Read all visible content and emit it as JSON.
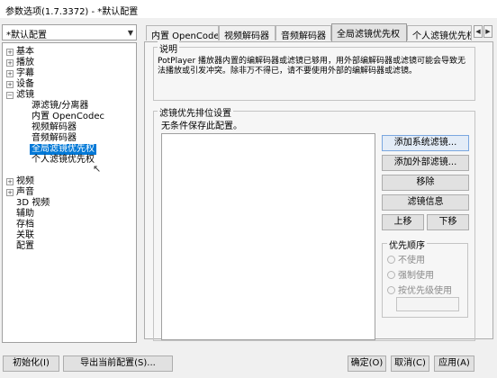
{
  "window": {
    "title": "参数选项(1.7.3372) - *默认配置"
  },
  "preset": {
    "value": "*默认配置"
  },
  "tabs": [
    {
      "label": "内置 OpenCodec"
    },
    {
      "label": "视频解码器"
    },
    {
      "label": "音频解码器"
    },
    {
      "label": "全局滤镜优先权"
    },
    {
      "label": "个人滤镜优先权"
    }
  ],
  "tree": {
    "items": [
      {
        "label": "基本",
        "exp": "+"
      },
      {
        "label": "播放",
        "exp": "+"
      },
      {
        "label": "字幕",
        "exp": "+"
      },
      {
        "label": "设备",
        "exp": "+"
      },
      {
        "label": "滤镜",
        "exp": "−"
      },
      {
        "label": "源滤镜/分离器"
      },
      {
        "label": "内置 OpenCodec"
      },
      {
        "label": "视频解码器"
      },
      {
        "label": "音频解码器"
      },
      {
        "label": "全局滤镜优先权"
      },
      {
        "label": "个人滤镜优先权"
      },
      {
        "label": "视频",
        "exp": "+"
      },
      {
        "label": "声音",
        "exp": "+"
      },
      {
        "label": "3D 视频"
      },
      {
        "label": "辅助"
      },
      {
        "label": "存档"
      },
      {
        "label": "关联"
      },
      {
        "label": "配置"
      }
    ]
  },
  "info": {
    "title": "说明",
    "text": "PotPlayer 播放器内置的编解码器或滤镜已够用，用外部编解码器或滤镜可能会导致无法播放或引发冲突。除非万不得已，请不要使用外部的编解码器或滤镜。"
  },
  "priority": {
    "title": "滤镜优先排位设置",
    "status": "无条件保存此配置。",
    "buttons": {
      "add_system": "添加系统滤镜...",
      "add_external": "添加外部滤镜...",
      "remove": "移除",
      "info": "滤镜信息",
      "up": "上移",
      "down": "下移"
    },
    "order_title": "优先顺序",
    "options": [
      "不使用",
      "强制使用",
      "按优先级使用"
    ]
  },
  "footer": {
    "init": "初始化(I)",
    "export": "导出当前配置(S)...",
    "ok": "确定(O)",
    "cancel": "取消(C)",
    "apply": "应用(A)"
  },
  "colors": {
    "selection": "#0078d7"
  }
}
